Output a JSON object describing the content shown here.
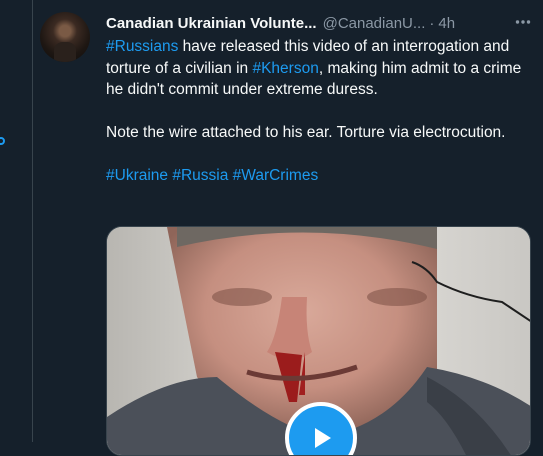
{
  "tweet": {
    "display_name": "Canadian Ukrainian Volunte...",
    "handle": "@CanadianU...",
    "separator": "·",
    "time": "4h",
    "paragraphs": [
      {
        "segments": [
          {
            "text": "#Russians",
            "hashtag": true
          },
          {
            "text": " have released this video of an interrogation and torture of a civilian in ",
            "hashtag": false
          },
          {
            "text": "#Kherson",
            "hashtag": true
          },
          {
            "text": ", making him admit to a crime he didn't commit under extreme duress.",
            "hashtag": false
          }
        ]
      },
      {
        "segments": [
          {
            "text": "Note the wire attached to his ear. Torture via electrocution.",
            "hashtag": false
          }
        ]
      },
      {
        "segments": [
          {
            "text": "#Ukraine",
            "hashtag": true
          },
          {
            "text": " ",
            "hashtag": false
          },
          {
            "text": "#Russia",
            "hashtag": true
          },
          {
            "text": " ",
            "hashtag": false
          },
          {
            "text": "#WarCrimes",
            "hashtag": true
          }
        ]
      }
    ]
  },
  "media": {
    "type": "video",
    "icon": "play-icon"
  },
  "colors": {
    "background": "#15202b",
    "text": "#f7f9f9",
    "muted": "#8b98a5",
    "accent": "#1d9bf0",
    "border": "#38444d"
  }
}
